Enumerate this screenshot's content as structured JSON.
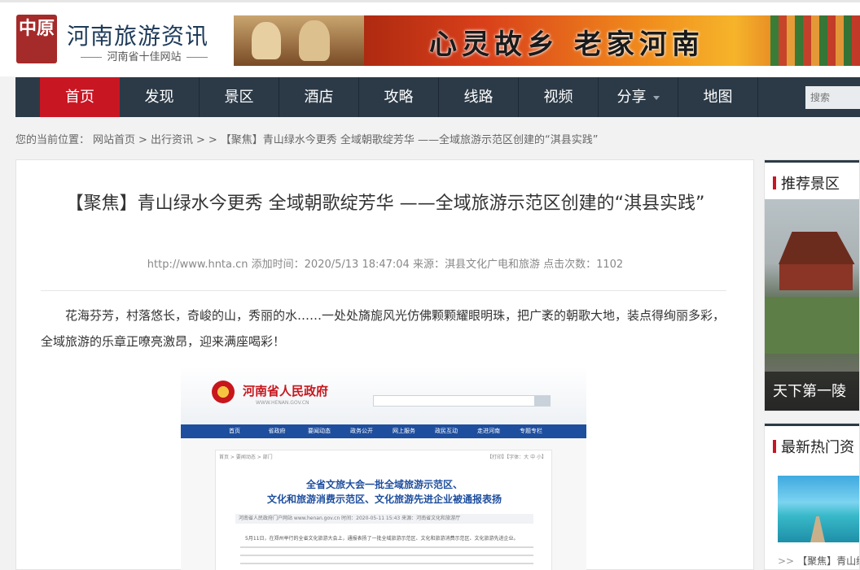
{
  "header": {
    "logo_mark": "中原",
    "site_title": "河南旅游资讯",
    "site_subtitle": "河南省十佳网站",
    "banner_slogan": "心灵故乡  老家河南"
  },
  "nav": {
    "items": [
      {
        "label": "首页",
        "active": true
      },
      {
        "label": "发现"
      },
      {
        "label": "景区"
      },
      {
        "label": "酒店"
      },
      {
        "label": "攻略"
      },
      {
        "label": "线路"
      },
      {
        "label": "视频"
      },
      {
        "label": "分享",
        "has_dropdown": true
      },
      {
        "label": "地图"
      }
    ],
    "search_placeholder": "搜索",
    "active_color": "#c81623",
    "bg_color": "#2c3a47"
  },
  "breadcrumb": {
    "prefix": "您的当前位置：",
    "items": [
      "网站首页",
      ">",
      "出行资讯",
      ">",
      ">",
      "【聚焦】青山绿水今更秀 全域朝歌绽芳华 ——全域旅游示范区创建的“淇县实践”"
    ]
  },
  "article": {
    "title": "【聚焦】青山绿水今更秀 全域朝歌绽芳华 ——全域旅游示范区创建的“淇县实践”",
    "meta": "http://www.hnta.cn 添加时间：2020/5/13 18:47:04 来源：淇县文化广电和旅游 点击次数：1102",
    "body": "花海芬芳，村落悠长，奇峻的山，秀丽的水……一处处旖旎风光仿佛颗颗耀眼明珠，把广袤的朝歌大地，装点得绚丽多彩，全域旅游的乐章正嘹亮激昂，迎来满座喝彩！"
  },
  "embedded_screenshot": {
    "brand": "河南省人民政府",
    "url": "WWW.HENAN.GOV.CN",
    "nav": [
      "首页",
      "省政府",
      "要闻动态",
      "政务公开",
      "网上服务",
      "政民互动",
      "走进河南",
      "专题专栏"
    ],
    "crumb": "首页 > 要闻动态 > 部门",
    "print": "【打印】【字体：大 中 小】",
    "title_line1": "全省文旅大会一批全域旅游示范区、",
    "title_line2": "文化和旅游消费示范区、文化旅游先进企业被通报表扬",
    "meta": "河南省人民政府门户网站 www.henan.gov.cn    时间：2020-05-11 15:43    来源：河南省文化和旅游厅",
    "first_para": "5月11日，在郑州举行的全省文化旅游大会上，通报表扬了一批全域旅游示范区、文化和旅游消费示范区、文化旅游先进企业。"
  },
  "sidebar": {
    "recommended": {
      "title": "推荐景区",
      "caption": "天下第一陵"
    },
    "hot": {
      "title": "最新热门资",
      "item": "【聚焦】青山绿"
    }
  }
}
